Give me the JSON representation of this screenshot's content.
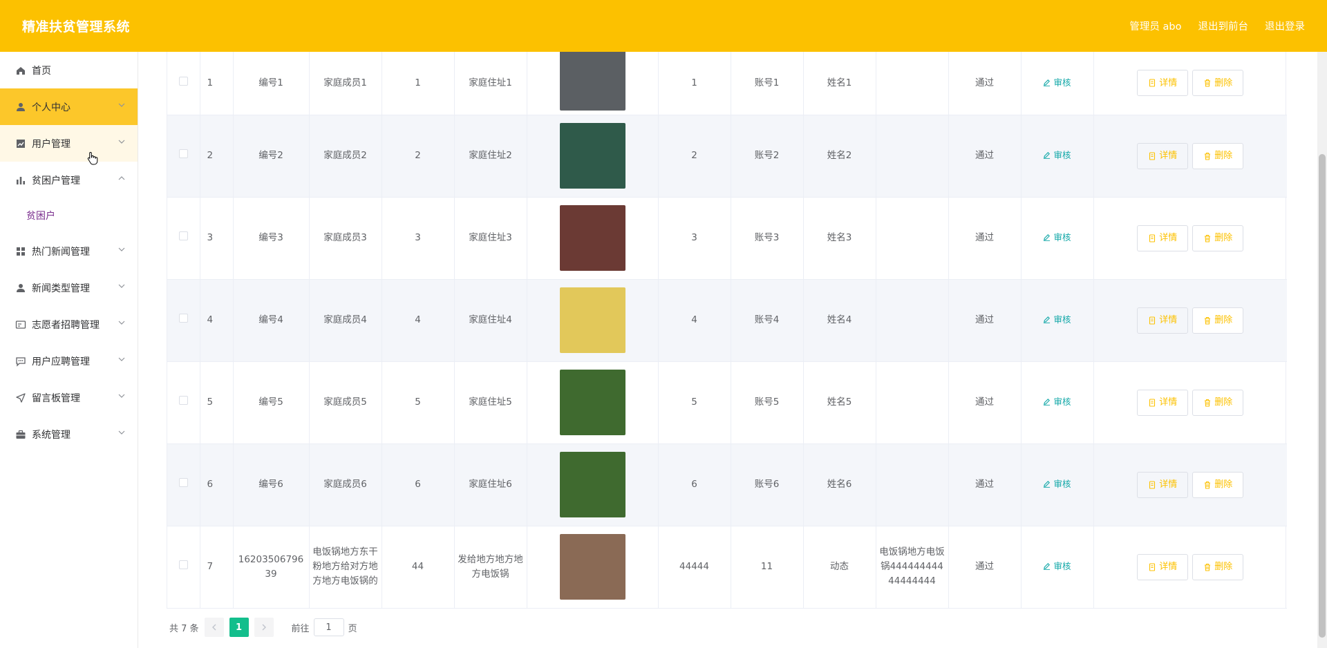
{
  "header": {
    "title": "精准扶贫管理系统",
    "admin": "管理员 abo",
    "front": "退出到前台",
    "logout": "退出登录"
  },
  "sidebar": {
    "items": [
      {
        "label": "首页",
        "icon": "home-icon",
        "state": "normal",
        "chevron": ""
      },
      {
        "label": "个人中心",
        "icon": "user-icon",
        "state": "active",
        "chevron": "down"
      },
      {
        "label": "用户管理",
        "icon": "chart-square-icon",
        "state": "hover",
        "chevron": "down"
      },
      {
        "label": "贫困户管理",
        "icon": "bar-chart-icon",
        "state": "normal",
        "chevron": "up"
      },
      {
        "label": "热门新闻管理",
        "icon": "grid-icon",
        "state": "normal",
        "chevron": "down"
      },
      {
        "label": "新闻类型管理",
        "icon": "user-icon",
        "state": "normal",
        "chevron": "down"
      },
      {
        "label": "志愿者招聘管理",
        "icon": "card-icon",
        "state": "normal",
        "chevron": "down"
      },
      {
        "label": "用户应聘管理",
        "icon": "message-icon",
        "state": "normal",
        "chevron": "down"
      },
      {
        "label": "留言板管理",
        "icon": "send-icon",
        "state": "normal",
        "chevron": "down"
      },
      {
        "label": "系统管理",
        "icon": "briefcase-icon",
        "state": "normal",
        "chevron": "down"
      }
    ],
    "submenu": "贫困户"
  },
  "table": {
    "audit_label": "审核",
    "detail_label": "详情",
    "delete_label": "删除",
    "rows": [
      {
        "idx": "1",
        "code": "编号1",
        "member": "家庭成员1",
        "num": "1",
        "address": "家庭住址1",
        "photo": "#5b5f63",
        "income": "1",
        "account": "账号1",
        "name": "姓名1",
        "remark": "",
        "status": "通过"
      },
      {
        "idx": "2",
        "code": "编号2",
        "member": "家庭成员2",
        "num": "2",
        "address": "家庭住址2",
        "photo": "#2f5a4a",
        "income": "2",
        "account": "账号2",
        "name": "姓名2",
        "remark": "",
        "status": "通过"
      },
      {
        "idx": "3",
        "code": "编号3",
        "member": "家庭成员3",
        "num": "3",
        "address": "家庭住址3",
        "photo": "#6b3a34",
        "income": "3",
        "account": "账号3",
        "name": "姓名3",
        "remark": "",
        "status": "通过"
      },
      {
        "idx": "4",
        "code": "编号4",
        "member": "家庭成员4",
        "num": "4",
        "address": "家庭住址4",
        "photo": "#e2c85a",
        "income": "4",
        "account": "账号4",
        "name": "姓名4",
        "remark": "",
        "status": "通过"
      },
      {
        "idx": "5",
        "code": "编号5",
        "member": "家庭成员5",
        "num": "5",
        "address": "家庭住址5",
        "photo": "#3f6a2f",
        "income": "5",
        "account": "账号5",
        "name": "姓名5",
        "remark": "",
        "status": "通过"
      },
      {
        "idx": "6",
        "code": "编号6",
        "member": "家庭成员6",
        "num": "6",
        "address": "家庭住址6",
        "photo": "#3f6a2f",
        "income": "6",
        "account": "账号6",
        "name": "姓名6",
        "remark": "",
        "status": "通过"
      },
      {
        "idx": "7",
        "code": "1620350679639",
        "member": "电饭锅地方东干粉地方给对方地方地方电饭锅的",
        "num": "44",
        "address": "发给地方地方地方电饭锅",
        "photo": "#8a6a55",
        "income": "44444",
        "account": "11",
        "name": "动态",
        "remark": "电饭锅地方电饭锅44444444444444444",
        "status": "通过"
      }
    ]
  },
  "pagination": {
    "total": "共 7 条",
    "current": "1",
    "goto": "前往",
    "page_value": "1",
    "page_unit": "页"
  }
}
